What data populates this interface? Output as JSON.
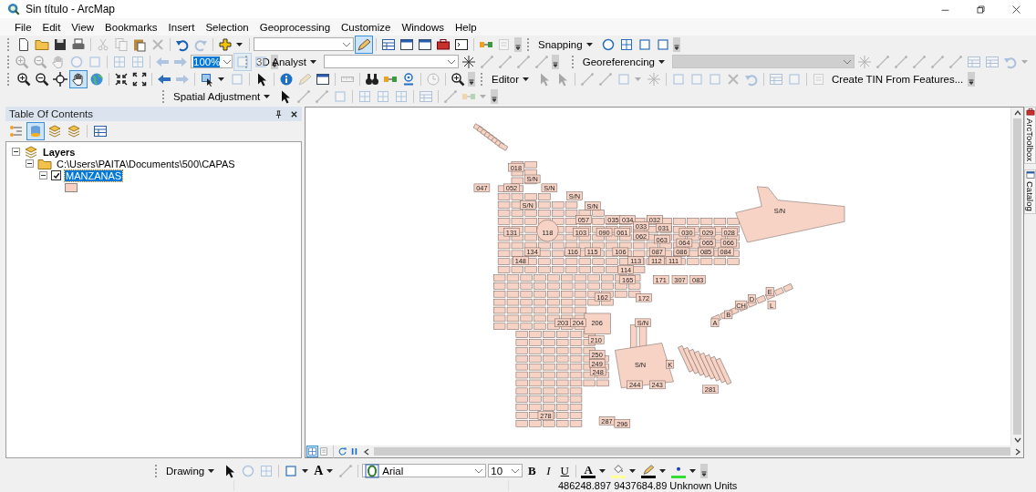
{
  "window": {
    "title": "Sin título - ArcMap"
  },
  "menu": [
    "File",
    "Edit",
    "View",
    "Bookmarks",
    "Insert",
    "Selection",
    "Geoprocessing",
    "Customize",
    "Windows",
    "Help"
  ],
  "toolbar_rows": [
    [
      {
        "items": [
          {
            "kind": "icon",
            "disabled": false,
            "selected": false
          },
          {
            "kind": "icon",
            "disabled": false,
            "selected": false
          },
          {
            "kind": "icon",
            "disabled": false,
            "selected": false
          },
          {
            "kind": "icon",
            "disabled": false,
            "selected": false
          },
          {
            "kind": "sep"
          },
          {
            "kind": "icon",
            "disabled": true,
            "selected": false
          },
          {
            "kind": "icon",
            "disabled": true,
            "selected": false
          },
          {
            "kind": "icon",
            "disabled": false,
            "selected": false
          },
          {
            "kind": "icon",
            "disabled": true,
            "selected": false
          },
          {
            "kind": "sep"
          },
          {
            "kind": "icon",
            "disabled": false,
            "selected": false
          },
          {
            "kind": "icon",
            "disabled": true,
            "selected": false
          },
          {
            "kind": "sep"
          },
          {
            "kind": "icon-menu",
            "disabled": false,
            "selected": false
          },
          {
            "kind": "sep"
          },
          {
            "kind": "combo",
            "disabled": false
          },
          {
            "kind": "icon",
            "disabled": false,
            "selected": true
          },
          {
            "kind": "sep"
          },
          {
            "kind": "icon",
            "disabled": false,
            "selected": false
          },
          {
            "kind": "icon",
            "disabled": false,
            "selected": false
          },
          {
            "kind": "icon",
            "disabled": false,
            "selected": false
          },
          {
            "kind": "icon",
            "disabled": false,
            "selected": false
          },
          {
            "kind": "icon",
            "disabled": false,
            "selected": false
          },
          {
            "kind": "sep"
          },
          {
            "kind": "icon",
            "disabled": false,
            "selected": false
          },
          {
            "kind": "icon",
            "disabled": true,
            "selected": false
          },
          {
            "kind": "overflow"
          }
        ]
      },
      {
        "items": [
          {
            "kind": "menu",
            "label": "Snapping"
          },
          {
            "kind": "icon",
            "disabled": false,
            "selected": false
          },
          {
            "kind": "icon",
            "disabled": false,
            "selected": false
          },
          {
            "kind": "icon",
            "disabled": false,
            "selected": false
          },
          {
            "kind": "icon",
            "disabled": false,
            "selected": false
          },
          {
            "kind": "overflow"
          }
        ]
      }
    ],
    [
      {
        "items": [
          {
            "kind": "icon",
            "disabled": true,
            "selected": false
          },
          {
            "kind": "icon",
            "disabled": true,
            "selected": false
          },
          {
            "kind": "icon",
            "disabled": true,
            "selected": false
          },
          {
            "kind": "icon",
            "disabled": true,
            "selected": false
          },
          {
            "kind": "icon",
            "disabled": true,
            "selected": false
          },
          {
            "kind": "sep"
          },
          {
            "kind": "icon",
            "disabled": true,
            "selected": false
          },
          {
            "kind": "icon",
            "disabled": true,
            "selected": false
          },
          {
            "kind": "sep"
          },
          {
            "kind": "icon",
            "disabled": true,
            "selected": false
          },
          {
            "kind": "icon",
            "disabled": true,
            "selected": false
          },
          {
            "kind": "combo",
            "disabled": false,
            "value": "100%",
            "highlighted": true
          },
          {
            "kind": "icon",
            "disabled": true,
            "selected": true
          },
          {
            "kind": "icon",
            "disabled": true,
            "selected": false
          },
          {
            "kind": "overflow"
          }
        ]
      },
      {
        "items": [
          {
            "kind": "menu",
            "label": "3D Analyst"
          },
          {
            "kind": "combo",
            "disabled": false
          },
          {
            "kind": "icon",
            "disabled": false,
            "selected": false
          },
          {
            "kind": "icon",
            "disabled": true,
            "selected": false
          },
          {
            "kind": "icon",
            "disabled": true,
            "selected": false
          },
          {
            "kind": "icon",
            "disabled": true,
            "selected": false
          },
          {
            "kind": "icon",
            "disabled": true,
            "selected": false
          },
          {
            "kind": "overflow"
          }
        ]
      },
      {
        "items": [
          {
            "kind": "menu",
            "label": "Georeferencing"
          },
          {
            "kind": "combo",
            "disabled": true
          },
          {
            "kind": "icon",
            "disabled": true,
            "selected": false
          },
          {
            "kind": "icon",
            "disabled": true,
            "selected": false
          },
          {
            "kind": "icon",
            "disabled": true,
            "selected": false
          },
          {
            "kind": "icon",
            "disabled": true,
            "selected": false
          },
          {
            "kind": "icon",
            "disabled": true,
            "selected": false
          },
          {
            "kind": "icon",
            "disabled": true,
            "selected": false
          },
          {
            "kind": "icon",
            "disabled": true,
            "selected": false
          },
          {
            "kind": "icon",
            "disabled": true,
            "selected": false
          },
          {
            "kind": "icon-menu",
            "disabled": true,
            "selected": false
          }
        ]
      }
    ],
    [
      {
        "items": [
          {
            "kind": "icon",
            "disabled": false,
            "selected": false
          },
          {
            "kind": "icon",
            "disabled": false,
            "selected": false
          },
          {
            "kind": "icon",
            "disabled": false,
            "selected": false
          },
          {
            "kind": "icon",
            "disabled": false,
            "selected": true
          },
          {
            "kind": "icon",
            "disabled": false,
            "selected": false
          },
          {
            "kind": "sep"
          },
          {
            "kind": "icon",
            "disabled": false,
            "selected": false
          },
          {
            "kind": "icon",
            "disabled": false,
            "selected": false
          },
          {
            "kind": "sep"
          },
          {
            "kind": "icon",
            "disabled": false,
            "selected": false
          },
          {
            "kind": "icon",
            "disabled": true,
            "selected": false
          },
          {
            "kind": "sep"
          },
          {
            "kind": "icon-menu",
            "disabled": false,
            "selected": false
          },
          {
            "kind": "icon",
            "disabled": true,
            "selected": false
          },
          {
            "kind": "sep"
          },
          {
            "kind": "icon",
            "disabled": false,
            "selected": false
          },
          {
            "kind": "sep"
          },
          {
            "kind": "icon",
            "disabled": false,
            "selected": false
          },
          {
            "kind": "icon",
            "disabled": true,
            "selected": false
          },
          {
            "kind": "icon",
            "disabled": false,
            "selected": false
          },
          {
            "kind": "sep"
          },
          {
            "kind": "icon",
            "disabled": true,
            "selected": false
          },
          {
            "kind": "sep"
          },
          {
            "kind": "icon",
            "disabled": false,
            "selected": false
          },
          {
            "kind": "icon",
            "disabled": false,
            "selected": false
          },
          {
            "kind": "icon",
            "disabled": false,
            "selected": false
          },
          {
            "kind": "sep"
          },
          {
            "kind": "icon",
            "disabled": true,
            "selected": false
          },
          {
            "kind": "sep"
          },
          {
            "kind": "icon",
            "disabled": false,
            "selected": false
          },
          {
            "kind": "overflow"
          }
        ]
      },
      {
        "items": [
          {
            "kind": "menu",
            "label": "Editor"
          },
          {
            "kind": "icon",
            "disabled": true,
            "selected": false
          },
          {
            "kind": "icon",
            "disabled": true,
            "selected": false
          },
          {
            "kind": "sep"
          },
          {
            "kind": "icon",
            "disabled": true,
            "selected": false
          },
          {
            "kind": "icon",
            "disabled": true,
            "selected": false
          },
          {
            "kind": "icon-menu",
            "disabled": true,
            "selected": false
          },
          {
            "kind": "icon",
            "disabled": true,
            "selected": false
          },
          {
            "kind": "sep"
          },
          {
            "kind": "icon",
            "disabled": true,
            "selected": false
          },
          {
            "kind": "icon",
            "disabled": true,
            "selected": false
          },
          {
            "kind": "icon",
            "disabled": true,
            "selected": false
          },
          {
            "kind": "icon",
            "disabled": true,
            "selected": false
          },
          {
            "kind": "icon",
            "disabled": true,
            "selected": false
          },
          {
            "kind": "sep"
          },
          {
            "kind": "icon",
            "disabled": true,
            "selected": false
          },
          {
            "kind": "icon",
            "disabled": true,
            "selected": false
          },
          {
            "kind": "sep"
          },
          {
            "kind": "icon",
            "disabled": true,
            "selected": false
          },
          {
            "kind": "button",
            "label": "Create TIN From Features..."
          },
          {
            "kind": "overflow"
          }
        ]
      }
    ],
    [
      {
        "items": [
          {
            "kind": "menu",
            "label": "Spatial Adjustment"
          },
          {
            "kind": "icon",
            "disabled": false,
            "selected": false
          },
          {
            "kind": "icon",
            "disabled": true,
            "selected": false
          },
          {
            "kind": "icon",
            "disabled": true,
            "selected": false
          },
          {
            "kind": "icon",
            "disabled": true,
            "selected": false
          },
          {
            "kind": "sep"
          },
          {
            "kind": "icon",
            "disabled": true,
            "selected": false
          },
          {
            "kind": "icon",
            "disabled": true,
            "selected": false
          },
          {
            "kind": "icon",
            "disabled": true,
            "selected": false
          },
          {
            "kind": "sep"
          },
          {
            "kind": "icon",
            "disabled": true,
            "selected": false
          },
          {
            "kind": "sep"
          },
          {
            "kind": "icon",
            "disabled": true,
            "selected": false
          },
          {
            "kind": "icon-menu",
            "disabled": true,
            "selected": false
          },
          {
            "kind": "overflow"
          }
        ]
      }
    ]
  ],
  "table_of_contents": {
    "title": "Table Of Contents",
    "tools": [
      {
        "selected": false
      },
      {
        "selected": true
      },
      {
        "selected": false
      },
      {
        "selected": false
      },
      {
        "selected": false
      }
    ],
    "tree": [
      {
        "kind": "group",
        "label": "Layers",
        "expanded": true,
        "selected": false,
        "children": [
          {
            "kind": "folder",
            "label": "C:\\Users\\PAITA\\Documents\\500\\CAPAS",
            "expanded": true,
            "selected": false,
            "children": [
              {
                "kind": "layer",
                "label": "MANZANAS",
                "expanded": true,
                "checked": true,
                "selected": true,
                "color": "#f8d0c2"
              }
            ]
          }
        ]
      }
    ]
  },
  "map_labels": [
    "018",
    "S/N",
    "047",
    "052",
    "S/N",
    "S/N",
    "S/N",
    "S/N",
    "S/N",
    "057",
    "035",
    "034",
    "032",
    "033",
    "031",
    "131",
    "118",
    "103",
    "090",
    "061",
    "030",
    "029",
    "028",
    "062",
    "063",
    "064",
    "065",
    "066",
    "134",
    "116",
    "115",
    "106",
    "087",
    "086",
    "085",
    "084",
    "148",
    "113",
    "112",
    "111",
    "114",
    "165",
    "171",
    "307",
    "083",
    "E",
    "162",
    "172",
    "D",
    "CH",
    "L",
    "B",
    "203",
    "204",
    "206",
    "S/N",
    "A",
    "210",
    "250",
    "249",
    "S/N",
    "K",
    "248",
    "244",
    "243",
    "281",
    "278",
    "287",
    "296"
  ],
  "map_view_buttons": [
    {
      "selected": true
    },
    {
      "selected": false
    }
  ],
  "side_tabs": [
    {
      "label": "ArcToolbox"
    },
    {
      "label": "Catalog"
    }
  ],
  "drawing_toolbar": {
    "items": [
      {
        "kind": "menu",
        "label": "Drawing"
      },
      {
        "kind": "icon",
        "disabled": false,
        "selected": false
      },
      {
        "kind": "icon",
        "disabled": true,
        "selected": false
      },
      {
        "kind": "icon",
        "disabled": true,
        "selected": false
      },
      {
        "kind": "sep"
      },
      {
        "kind": "icon-menu",
        "disabled": false,
        "selected": false
      },
      {
        "kind": "text-menu",
        "label": "A"
      },
      {
        "kind": "icon",
        "disabled": true,
        "selected": false
      },
      {
        "kind": "sep"
      },
      {
        "kind": "font-combo",
        "value": "Arial"
      },
      {
        "kind": "combo",
        "disabled": false,
        "value": "10"
      },
      {
        "kind": "bold",
        "label": "B"
      },
      {
        "kind": "italic",
        "label": "I"
      },
      {
        "kind": "underline",
        "label": "U"
      },
      {
        "kind": "sep"
      },
      {
        "kind": "color-menu",
        "label": "A",
        "color": "#000000"
      },
      {
        "kind": "color-menu",
        "color": "#ffff99"
      },
      {
        "kind": "color-menu",
        "color": "#000000"
      },
      {
        "kind": "color-menu",
        "color": "#33dd33"
      },
      {
        "kind": "overflow"
      }
    ]
  },
  "status_bar": {
    "coordinates": "486248.897  9437684.89 Unknown Units"
  }
}
